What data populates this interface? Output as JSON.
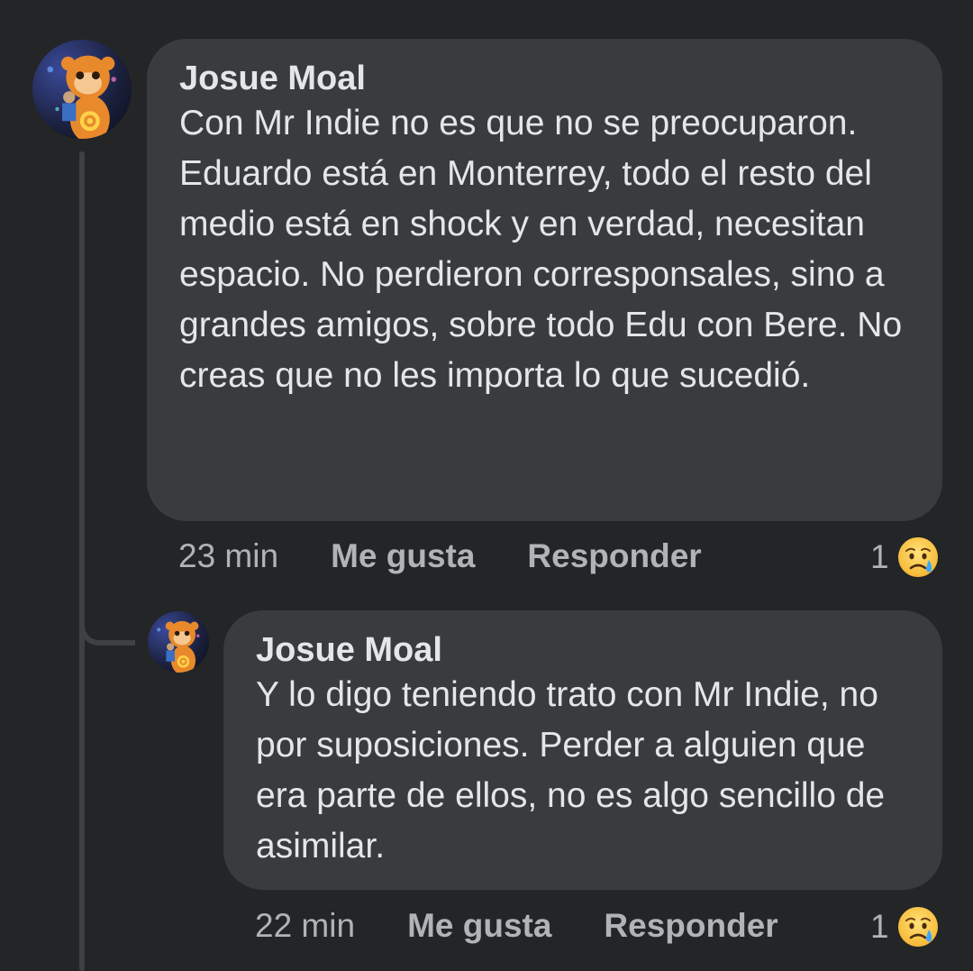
{
  "comment": {
    "author": "Josue Moal",
    "text": "Con Mr Indie no es que no se preocuparon. Eduardo está en Monterrey, todo el resto del medio está en shock y en verdad, necesitan espacio. No perdieron corresponsales, sino a grandes amigos, sobre todo Edu con Bere. No creas que no les importa lo que sucedió.",
    "time": "23 min",
    "like_label": "Me gusta",
    "reply_label": "Responder",
    "reaction_count": "1",
    "reaction_icon": "sad-tear-emoji"
  },
  "reply": {
    "author": "Josue Moal",
    "text": "Y lo digo teniendo trato con Mr Indie, no por suposiciones. Perder a alguien que era parte de ellos, no es algo sencillo de asimilar.",
    "time": "22 min",
    "like_label": "Me gusta",
    "reply_label": "Responder",
    "reaction_count": "1",
    "reaction_icon": "sad-tear-emoji"
  },
  "colors": {
    "background": "#242526",
    "bubble": "#3a3b3c",
    "primary_text": "#e4e6eb",
    "secondary_text": "#b0b3b8",
    "thread_line": "#3e4042"
  }
}
